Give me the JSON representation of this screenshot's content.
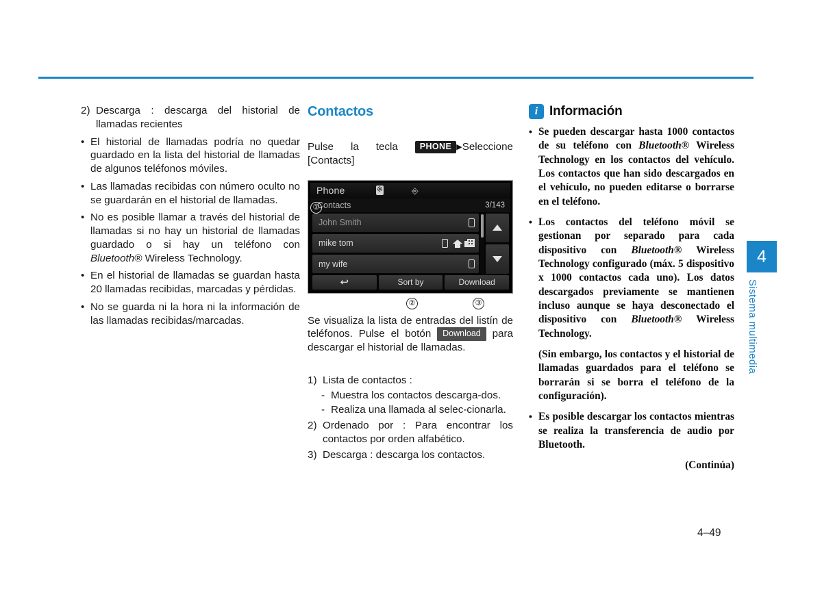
{
  "page": {
    "number": "4–49",
    "side_tab_number": "4",
    "side_tab_label": "Sistema multimedia",
    "accent_color": "#1a86c8"
  },
  "left_column": {
    "item_2": {
      "marker": "2)",
      "text": "Descarga : descarga del historial de llamadas recientes"
    },
    "bullets": [
      "El historial de llamadas podría no quedar guardado en la lista del historial de llamadas de algunos teléfonos móviles.",
      "Las llamadas recibidas con número oculto no se guardarán en el historial de llamadas.",
      "En el historial de llamadas se guardan hasta 20 llamadas recibidas, marcadas y pérdidas.",
      "No se guarda ni la hora ni la información de las llamadas recibidas/marcadas."
    ],
    "bullet_bluetooth": {
      "before": "No es posible llamar a través del historial de llamadas si no hay un historial de llamadas guardado o si hay un teléfono con ",
      "italic": "Bluetooth®",
      "after": " Wireless Technology."
    }
  },
  "middle_column": {
    "heading": "Contactos",
    "instruction": {
      "before": "Pulse la tecla ",
      "key_badge": "PHONE",
      "arrow": "▶",
      "after": "Seleccione [Contacts]"
    },
    "screen": {
      "title": "Phone",
      "bluetooth_icon": "bluetooth-icon",
      "usb_icon": "usb-icon",
      "subtitle": "Contacts",
      "count": "3/143",
      "rows": [
        {
          "name": "John Smith",
          "icons": [
            "mobile"
          ]
        },
        {
          "name": "mike tom",
          "icons": [
            "mobile",
            "home",
            "office"
          ]
        },
        {
          "name": "my wife",
          "icons": [
            "mobile"
          ]
        }
      ],
      "footer": {
        "back": "↩",
        "sort": "Sort by",
        "download": "Download"
      },
      "callouts": {
        "one": "①",
        "two": "②",
        "three": "③"
      }
    },
    "description": {
      "before": "Se visualiza la lista de entradas del listín de teléfonos. Pulse el botón ",
      "badge": "Download",
      "after": " para descargar el historial de llamadas."
    },
    "numbered": [
      {
        "marker": "1)",
        "text": "Lista de contactos :"
      },
      {
        "marker": "2)",
        "text": "Ordenado por : Para encontrar los contactos por orden alfabético."
      },
      {
        "marker": "3)",
        "text": "Descarga : descarga los contactos."
      }
    ],
    "dashes": [
      "Muestra los contactos descarga-dos.",
      "Realiza una llamada al selec-cionarla."
    ],
    "dash_1": "Muestra los contactos descarga‑dos.",
    "dash_2": "Realiza una llamada al selec‑cionarla."
  },
  "right_column": {
    "title": "Información",
    "badge_glyph": "i",
    "bullet_1": {
      "p1": "Se pueden descargar hasta 1000 contactos de su teléfono con ",
      "bt": "Bluetooth®",
      "p2": " Wireless Technology en los contactos del vehículo. Los contactos que han sido descargados en el vehículo, no pueden editarse o borrarse en el teléfono."
    },
    "bullet_2": {
      "p1": "Los contactos del teléfono móvil se gestionan por separado para cada dispositivo con ",
      "bt1": "Bluetooth®",
      "p2": " Wireless Technology configurado (máx. 5 dispositivo x 1000 contactos cada uno). Los datos descargados previamente se mantienen incluso aunque se haya desconectado el dispositivo con ",
      "bt2": "Bluetooth®",
      "p3": " Wireless Technology."
    },
    "paragraph": "(Sin embargo, los contactos y el historial de llamadas guardados para el teléfono se borrarán si se borra el teléfono de la configuración).",
    "bullet_3": "Es posible descargar los contactos mientras se realiza la transferencia de audio por Bluetooth.",
    "continua": "(Continúa)"
  }
}
